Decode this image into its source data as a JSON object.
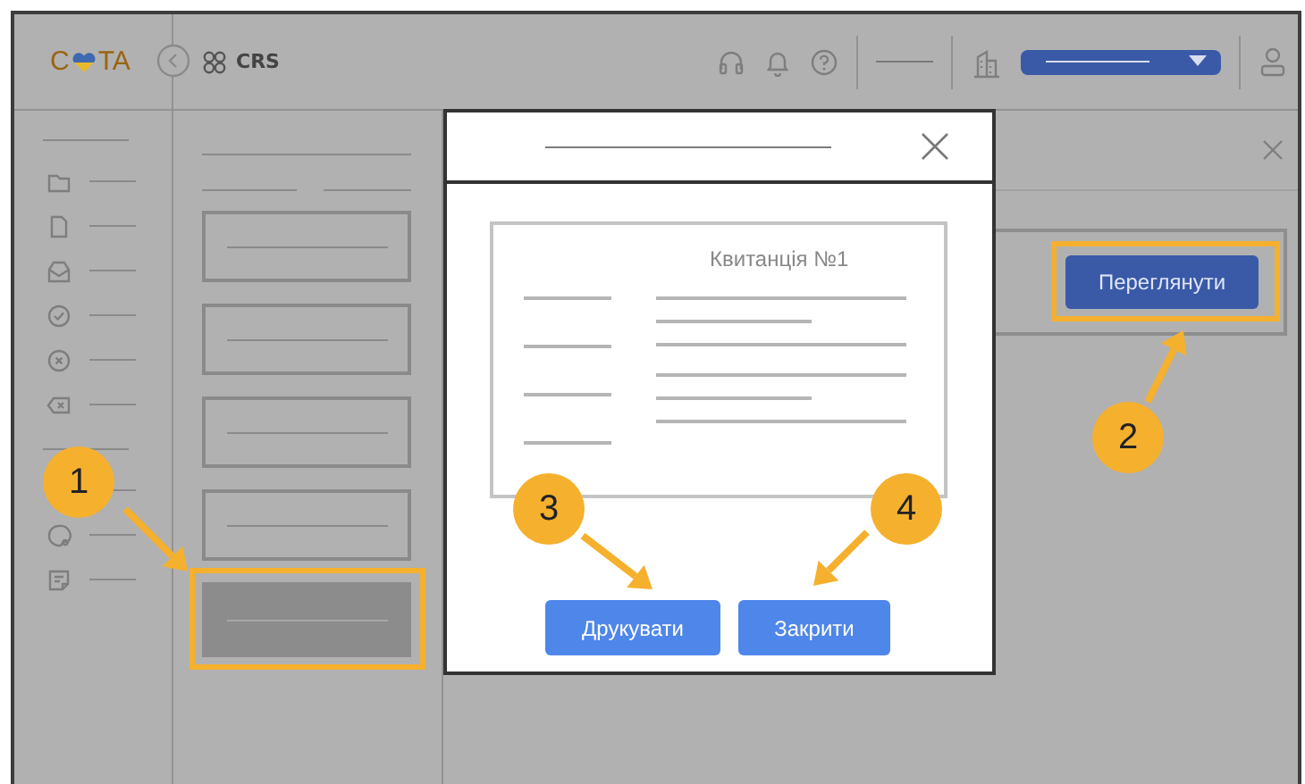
{
  "header": {
    "logo_start": "C",
    "logo_end": "TA",
    "app_name": "CRS"
  },
  "list": {
    "items": [
      {
        "selected": false,
        "highlighted": false
      },
      {
        "selected": false,
        "highlighted": false
      },
      {
        "selected": false,
        "highlighted": false
      },
      {
        "selected": false,
        "highlighted": false
      },
      {
        "selected": true,
        "highlighted": true
      }
    ]
  },
  "panel": {
    "action_button": "Переглянути",
    "highlighted": true
  },
  "dialog": {
    "receipt_title": "Квитанція №1",
    "buttons": [
      {
        "label": "Друкувати"
      },
      {
        "label": "Закрити"
      }
    ]
  },
  "callouts": [
    {
      "label": "1"
    },
    {
      "label": "2"
    },
    {
      "label": "3"
    },
    {
      "label": "4"
    }
  ]
}
